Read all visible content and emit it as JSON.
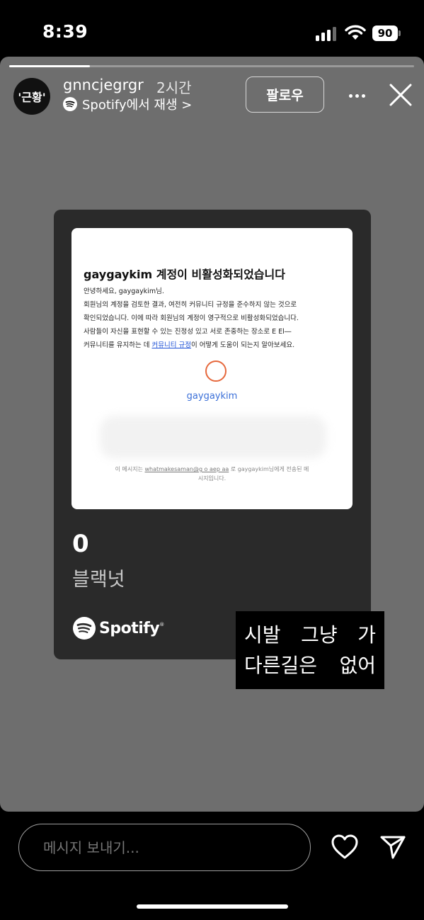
{
  "status_bar": {
    "time": "8:39",
    "battery": "90",
    "icons": [
      "cellular-signal-icon",
      "wifi-icon",
      "battery-icon"
    ]
  },
  "story": {
    "progress": 0.2,
    "avatar_text": "'근황'",
    "username": "gnncjegrgr",
    "time_ago": "2시간",
    "source_label": "Spotify에서 재생 >",
    "follow_label": "팔로우",
    "icons": [
      "more-icon",
      "close-icon",
      "spotify-icon"
    ],
    "background_color": "#6e6e6e"
  },
  "card": {
    "screenshot": {
      "title": "gaygaykim 계정이 비활성화되었습니다",
      "greeting": "안녕하세요, gaygaykim님.",
      "body_line1": "회원님의 계정을 검토한 결과, 여전히 커뮤니티 규정을 준수하지 않는 것으로",
      "body_line2": "확인되었습니다. 이에 따라 회원님의 계정이 영구적으로 비활성화되었습니다.",
      "body_line3": "사람들이 자신을 표현할 수 있는 진정성 있고 서로 존중하는 장소로 E El―",
      "body_line4_before": "커뮤니티를 유지하는 데 ",
      "body_line4_link": "커뮤니티 규정",
      "body_line4_after": "이 어떻게 도움이 되는지 알아보세요.",
      "account_name": "gaygaykim",
      "footer_line1_before": "이 메시지는 ",
      "footer_line1_email": "whatmakesaman@g o aep aa",
      "footer_line1_after": " 로 gaygaykim님에게 전송된 메",
      "footer_line2": "시지입니다."
    },
    "track_count": "0",
    "track_name": "블랙넛",
    "brand": "Spotify",
    "brand_mark": "®"
  },
  "caption": {
    "line1": "시발 그냥 가",
    "line2": "다른길은 없어"
  },
  "reply": {
    "placeholder": "메시지 보내기...",
    "icons": [
      "heart-icon",
      "send-icon"
    ]
  }
}
